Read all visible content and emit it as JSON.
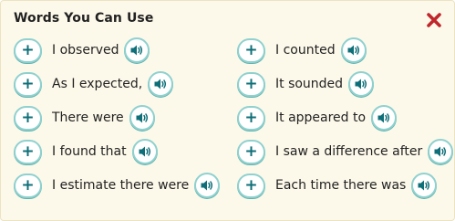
{
  "panel": {
    "title": "Words You Can Use",
    "close_icon": "close-x-icon",
    "close_color": "#c0262c",
    "accent_border": "#8fd1cf",
    "accent_icon": "#0f6f78",
    "background": "#fdf9ea"
  },
  "add_icon_glyph": "+",
  "columns": [
    {
      "items": [
        {
          "text": "I observed"
        },
        {
          "text": "As I expected,"
        },
        {
          "text": "There were"
        },
        {
          "text": "I found that"
        },
        {
          "text": "I estimate there were"
        }
      ]
    },
    {
      "items": [
        {
          "text": "I counted"
        },
        {
          "text": "It sounded"
        },
        {
          "text": "It appeared to"
        },
        {
          "text": "I saw a difference after"
        },
        {
          "text": "Each time there was"
        }
      ]
    }
  ]
}
